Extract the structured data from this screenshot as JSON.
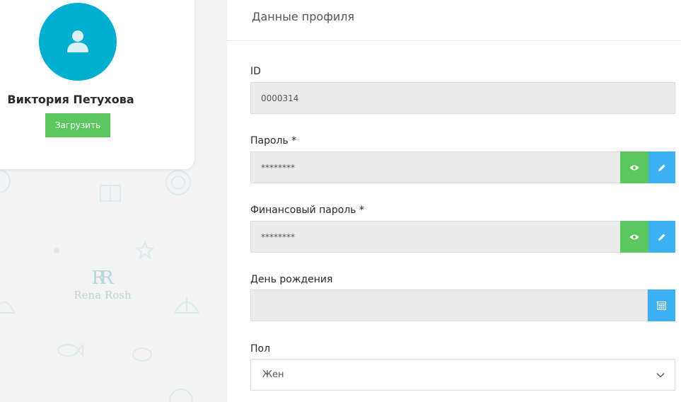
{
  "profile": {
    "name": "Виктория Петухова",
    "upload_label": "Загрузить"
  },
  "brand": {
    "logo_mark": "RR",
    "logo_text": "Rena Rosh"
  },
  "panel": {
    "title": "Данные профиля"
  },
  "fields": {
    "id": {
      "label": "ID",
      "value": "0000314"
    },
    "password": {
      "label": "Пароль *",
      "value": "********"
    },
    "finance_password": {
      "label": "Финансовый пароль *",
      "value": "********"
    },
    "birthday": {
      "label": "День рождения",
      "value": ""
    },
    "gender": {
      "label": "Пол",
      "value": "Жен"
    }
  },
  "colors": {
    "avatar": "#00afd0",
    "green": "#5cc65f",
    "blue": "#3db0f3"
  },
  "icons": {
    "avatar": "user-icon",
    "show": "eye-icon",
    "edit": "pencil-icon",
    "calendar": "calendar-icon",
    "dropdown": "chevron-down-icon"
  }
}
